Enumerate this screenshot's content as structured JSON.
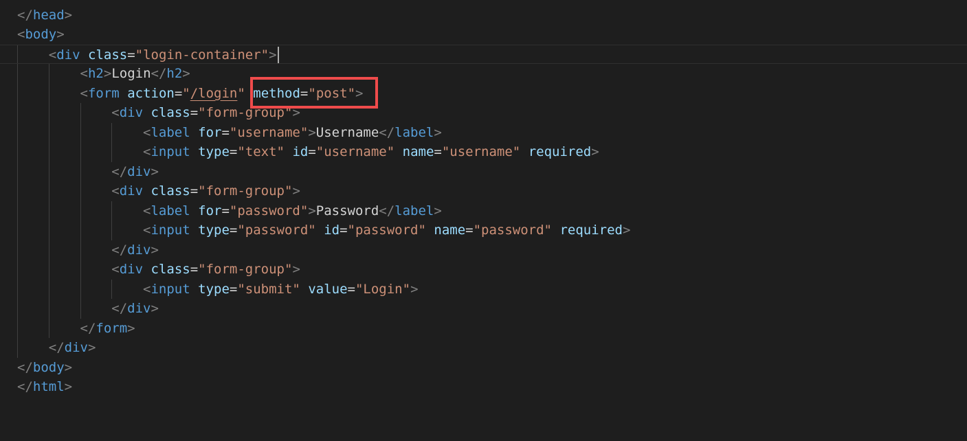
{
  "colors": {
    "background": "#1e1e1e",
    "punctuation": "#808080",
    "tag": "#569cd6",
    "attribute": "#9cdcfe",
    "string": "#ce9178",
    "text": "#d4d4d4",
    "highlight_box": "#ef4b4b"
  },
  "lines": [
    {
      "indent": "",
      "tokens": [
        {
          "k": "p",
          "v": "</"
        },
        {
          "k": "t",
          "v": "head"
        },
        {
          "k": "p",
          "v": ">"
        }
      ]
    },
    {
      "indent": "",
      "tokens": [
        {
          "k": "p",
          "v": "<"
        },
        {
          "k": "t",
          "v": "body"
        },
        {
          "k": "p",
          "v": ">"
        }
      ]
    },
    {
      "indent": "    ",
      "current": true,
      "cursor": true,
      "tokens": [
        {
          "k": "p",
          "v": "<"
        },
        {
          "k": "t",
          "v": "div"
        },
        {
          "k": "tx",
          "v": " "
        },
        {
          "k": "a",
          "v": "class"
        },
        {
          "k": "tx",
          "v": "="
        },
        {
          "k": "s",
          "v": "\"login-container\""
        },
        {
          "k": "p",
          "v": ">"
        }
      ]
    },
    {
      "indent": "        ",
      "tokens": [
        {
          "k": "p",
          "v": "<"
        },
        {
          "k": "t",
          "v": "h2"
        },
        {
          "k": "p",
          "v": ">"
        },
        {
          "k": "tx",
          "v": "Login"
        },
        {
          "k": "p",
          "v": "</"
        },
        {
          "k": "t",
          "v": "h2"
        },
        {
          "k": "p",
          "v": ">"
        }
      ]
    },
    {
      "indent": "        ",
      "tokens": [
        {
          "k": "p",
          "v": "<"
        },
        {
          "k": "t",
          "v": "form"
        },
        {
          "k": "tx",
          "v": " "
        },
        {
          "k": "a",
          "v": "action"
        },
        {
          "k": "tx",
          "v": "="
        },
        {
          "k": "s",
          "v": "\""
        },
        {
          "k": "s",
          "v": "/login",
          "underline": true
        },
        {
          "k": "s",
          "v": "\""
        },
        {
          "k": "tx",
          "v": " "
        },
        {
          "k": "a",
          "v": "method"
        },
        {
          "k": "tx",
          "v": "="
        },
        {
          "k": "s",
          "v": "\"post\""
        },
        {
          "k": "p",
          "v": ">"
        }
      ]
    },
    {
      "indent": "            ",
      "tokens": [
        {
          "k": "p",
          "v": "<"
        },
        {
          "k": "t",
          "v": "div"
        },
        {
          "k": "tx",
          "v": " "
        },
        {
          "k": "a",
          "v": "class"
        },
        {
          "k": "tx",
          "v": "="
        },
        {
          "k": "s",
          "v": "\"form-group\""
        },
        {
          "k": "p",
          "v": ">"
        }
      ]
    },
    {
      "indent": "                ",
      "tokens": [
        {
          "k": "p",
          "v": "<"
        },
        {
          "k": "t",
          "v": "label"
        },
        {
          "k": "tx",
          "v": " "
        },
        {
          "k": "a",
          "v": "for"
        },
        {
          "k": "tx",
          "v": "="
        },
        {
          "k": "s",
          "v": "\"username\""
        },
        {
          "k": "p",
          "v": ">"
        },
        {
          "k": "tx",
          "v": "Username"
        },
        {
          "k": "p",
          "v": "</"
        },
        {
          "k": "t",
          "v": "label"
        },
        {
          "k": "p",
          "v": ">"
        }
      ]
    },
    {
      "indent": "                ",
      "tokens": [
        {
          "k": "p",
          "v": "<"
        },
        {
          "k": "t",
          "v": "input"
        },
        {
          "k": "tx",
          "v": " "
        },
        {
          "k": "a",
          "v": "type"
        },
        {
          "k": "tx",
          "v": "="
        },
        {
          "k": "s",
          "v": "\"text\""
        },
        {
          "k": "tx",
          "v": " "
        },
        {
          "k": "a",
          "v": "id"
        },
        {
          "k": "tx",
          "v": "="
        },
        {
          "k": "s",
          "v": "\"username\""
        },
        {
          "k": "tx",
          "v": " "
        },
        {
          "k": "a",
          "v": "name"
        },
        {
          "k": "tx",
          "v": "="
        },
        {
          "k": "s",
          "v": "\"username\""
        },
        {
          "k": "tx",
          "v": " "
        },
        {
          "k": "a",
          "v": "required"
        },
        {
          "k": "p",
          "v": ">"
        }
      ]
    },
    {
      "indent": "            ",
      "tokens": [
        {
          "k": "p",
          "v": "</"
        },
        {
          "k": "t",
          "v": "div"
        },
        {
          "k": "p",
          "v": ">"
        }
      ]
    },
    {
      "indent": "            ",
      "tokens": [
        {
          "k": "p",
          "v": "<"
        },
        {
          "k": "t",
          "v": "div"
        },
        {
          "k": "tx",
          "v": " "
        },
        {
          "k": "a",
          "v": "class"
        },
        {
          "k": "tx",
          "v": "="
        },
        {
          "k": "s",
          "v": "\"form-group\""
        },
        {
          "k": "p",
          "v": ">"
        }
      ]
    },
    {
      "indent": "                ",
      "tokens": [
        {
          "k": "p",
          "v": "<"
        },
        {
          "k": "t",
          "v": "label"
        },
        {
          "k": "tx",
          "v": " "
        },
        {
          "k": "a",
          "v": "for"
        },
        {
          "k": "tx",
          "v": "="
        },
        {
          "k": "s",
          "v": "\"password\""
        },
        {
          "k": "p",
          "v": ">"
        },
        {
          "k": "tx",
          "v": "Password"
        },
        {
          "k": "p",
          "v": "</"
        },
        {
          "k": "t",
          "v": "label"
        },
        {
          "k": "p",
          "v": ">"
        }
      ]
    },
    {
      "indent": "                ",
      "tokens": [
        {
          "k": "p",
          "v": "<"
        },
        {
          "k": "t",
          "v": "input"
        },
        {
          "k": "tx",
          "v": " "
        },
        {
          "k": "a",
          "v": "type"
        },
        {
          "k": "tx",
          "v": "="
        },
        {
          "k": "s",
          "v": "\"password\""
        },
        {
          "k": "tx",
          "v": " "
        },
        {
          "k": "a",
          "v": "id"
        },
        {
          "k": "tx",
          "v": "="
        },
        {
          "k": "s",
          "v": "\"password\""
        },
        {
          "k": "tx",
          "v": " "
        },
        {
          "k": "a",
          "v": "name"
        },
        {
          "k": "tx",
          "v": "="
        },
        {
          "k": "s",
          "v": "\"password\""
        },
        {
          "k": "tx",
          "v": " "
        },
        {
          "k": "a",
          "v": "required"
        },
        {
          "k": "p",
          "v": ">"
        }
      ]
    },
    {
      "indent": "            ",
      "tokens": [
        {
          "k": "p",
          "v": "</"
        },
        {
          "k": "t",
          "v": "div"
        },
        {
          "k": "p",
          "v": ">"
        }
      ]
    },
    {
      "indent": "            ",
      "tokens": [
        {
          "k": "p",
          "v": "<"
        },
        {
          "k": "t",
          "v": "div"
        },
        {
          "k": "tx",
          "v": " "
        },
        {
          "k": "a",
          "v": "class"
        },
        {
          "k": "tx",
          "v": "="
        },
        {
          "k": "s",
          "v": "\"form-group\""
        },
        {
          "k": "p",
          "v": ">"
        }
      ]
    },
    {
      "indent": "                ",
      "tokens": [
        {
          "k": "p",
          "v": "<"
        },
        {
          "k": "t",
          "v": "input"
        },
        {
          "k": "tx",
          "v": " "
        },
        {
          "k": "a",
          "v": "type"
        },
        {
          "k": "tx",
          "v": "="
        },
        {
          "k": "s",
          "v": "\"submit\""
        },
        {
          "k": "tx",
          "v": " "
        },
        {
          "k": "a",
          "v": "value"
        },
        {
          "k": "tx",
          "v": "="
        },
        {
          "k": "s",
          "v": "\"Login\""
        },
        {
          "k": "p",
          "v": ">"
        }
      ]
    },
    {
      "indent": "            ",
      "tokens": [
        {
          "k": "p",
          "v": "</"
        },
        {
          "k": "t",
          "v": "div"
        },
        {
          "k": "p",
          "v": ">"
        }
      ]
    },
    {
      "indent": "        ",
      "tokens": [
        {
          "k": "p",
          "v": "</"
        },
        {
          "k": "t",
          "v": "form"
        },
        {
          "k": "p",
          "v": ">"
        }
      ]
    },
    {
      "indent": "    ",
      "tokens": [
        {
          "k": "p",
          "v": "</"
        },
        {
          "k": "t",
          "v": "div"
        },
        {
          "k": "p",
          "v": ">"
        }
      ]
    },
    {
      "indent": "",
      "tokens": [
        {
          "k": "p",
          "v": "</"
        },
        {
          "k": "t",
          "v": "body"
        },
        {
          "k": "p",
          "v": ">"
        }
      ]
    },
    {
      "indent": "",
      "tokens": [
        {
          "k": "p",
          "v": "</"
        },
        {
          "k": "t",
          "v": "html"
        },
        {
          "k": "p",
          "v": ">"
        }
      ]
    }
  ]
}
